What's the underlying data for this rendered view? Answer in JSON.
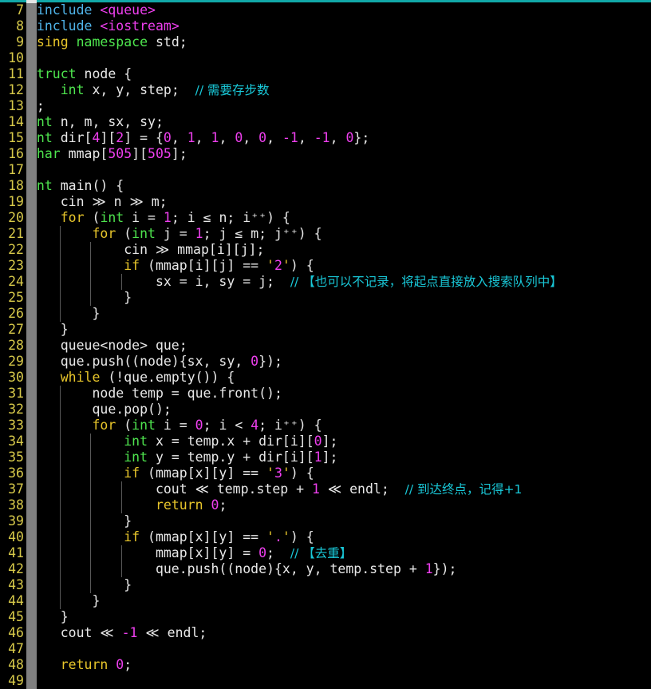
{
  "editor": {
    "language": "C++",
    "first_visible_line": 7,
    "last_visible_line": 49,
    "colors": {
      "background": "#000000",
      "line_number": "#d7c94a",
      "foreground": "#e8e8e8",
      "keyword": "#e8c62b",
      "type": "#4ee44e",
      "number": "#ee3fee",
      "preprocessor": "#4fb3e8",
      "header": "#ee3fee",
      "comment": "#19c8d8",
      "gutter_bar": "#808080",
      "top_rule": "#11a8a8",
      "indent_guide": "#585858"
    }
  },
  "lines": [
    {
      "no": "7",
      "indent_guides": 0,
      "tokens": [
        {
          "t": "#include",
          "c": "t-pre"
        },
        {
          "t": " ",
          "c": "t-plain"
        },
        {
          "t": "<queue>",
          "c": "t-hdr"
        }
      ]
    },
    {
      "no": "8",
      "indent_guides": 0,
      "tokens": [
        {
          "t": "#include",
          "c": "t-pre"
        },
        {
          "t": " ",
          "c": "t-plain"
        },
        {
          "t": "<iostream>",
          "c": "t-hdr"
        }
      ]
    },
    {
      "no": "9",
      "indent_guides": 0,
      "tokens": [
        {
          "t": "using",
          "c": "t-key"
        },
        {
          "t": " ",
          "c": "t-plain"
        },
        {
          "t": "namespace",
          "c": "t-type"
        },
        {
          "t": " std;",
          "c": "t-plain"
        }
      ]
    },
    {
      "no": "10",
      "indent_guides": 0,
      "tokens": []
    },
    {
      "no": "11",
      "indent_guides": 0,
      "tokens": [
        {
          "t": "struct",
          "c": "t-type"
        },
        {
          "t": " node {",
          "c": "t-plain"
        }
      ]
    },
    {
      "no": "12",
      "indent_guides": 0,
      "tokens": [
        {
          "t": "    ",
          "c": "t-plain"
        },
        {
          "t": "int",
          "c": "t-type"
        },
        {
          "t": " x, y, step;  ",
          "c": "t-plain"
        },
        {
          "t": "// 需要存步数",
          "c": "t-cmt"
        }
      ]
    },
    {
      "no": "13",
      "indent_guides": 0,
      "tokens": [
        {
          "t": "};",
          "c": "t-plain"
        }
      ]
    },
    {
      "no": "14",
      "indent_guides": 0,
      "tokens": [
        {
          "t": "int",
          "c": "t-type"
        },
        {
          "t": " n, m, sx, sy;",
          "c": "t-plain"
        }
      ]
    },
    {
      "no": "15",
      "indent_guides": 0,
      "tokens": [
        {
          "t": "int",
          "c": "t-type"
        },
        {
          "t": " dir[",
          "c": "t-plain"
        },
        {
          "t": "4",
          "c": "t-num"
        },
        {
          "t": "][",
          "c": "t-plain"
        },
        {
          "t": "2",
          "c": "t-num"
        },
        {
          "t": "] = {",
          "c": "t-plain"
        },
        {
          "t": "0",
          "c": "t-num"
        },
        {
          "t": ", ",
          "c": "t-plain"
        },
        {
          "t": "1",
          "c": "t-num"
        },
        {
          "t": ", ",
          "c": "t-plain"
        },
        {
          "t": "1",
          "c": "t-num"
        },
        {
          "t": ", ",
          "c": "t-plain"
        },
        {
          "t": "0",
          "c": "t-num"
        },
        {
          "t": ", ",
          "c": "t-plain"
        },
        {
          "t": "0",
          "c": "t-num"
        },
        {
          "t": ", ",
          "c": "t-plain"
        },
        {
          "t": "-1",
          "c": "t-num"
        },
        {
          "t": ", ",
          "c": "t-plain"
        },
        {
          "t": "-1",
          "c": "t-num"
        },
        {
          "t": ", ",
          "c": "t-plain"
        },
        {
          "t": "0",
          "c": "t-num"
        },
        {
          "t": "};",
          "c": "t-plain"
        }
      ]
    },
    {
      "no": "16",
      "indent_guides": 0,
      "tokens": [
        {
          "t": "char",
          "c": "t-type"
        },
        {
          "t": " mmap[",
          "c": "t-plain"
        },
        {
          "t": "505",
          "c": "t-num"
        },
        {
          "t": "][",
          "c": "t-plain"
        },
        {
          "t": "505",
          "c": "t-num"
        },
        {
          "t": "];",
          "c": "t-plain"
        }
      ]
    },
    {
      "no": "17",
      "indent_guides": 0,
      "tokens": []
    },
    {
      "no": "18",
      "indent_guides": 0,
      "tokens": [
        {
          "t": "int",
          "c": "t-type"
        },
        {
          "t": " main() {",
          "c": "t-plain"
        }
      ]
    },
    {
      "no": "19",
      "indent_guides": 0,
      "tokens": [
        {
          "t": "    cin ≫ n ≫ m;",
          "c": "t-plain"
        }
      ]
    },
    {
      "no": "20",
      "indent_guides": 0,
      "tokens": [
        {
          "t": "    ",
          "c": "t-plain"
        },
        {
          "t": "for",
          "c": "t-key"
        },
        {
          "t": " (",
          "c": "t-plain"
        },
        {
          "t": "int",
          "c": "t-type"
        },
        {
          "t": " i = ",
          "c": "t-plain"
        },
        {
          "t": "1",
          "c": "t-num"
        },
        {
          "t": "; i ≤ n; i⁺⁺) {",
          "c": "t-plain"
        }
      ]
    },
    {
      "no": "21",
      "indent_guides": 1,
      "tokens": [
        {
          "t": "        ",
          "c": "t-plain"
        },
        {
          "t": "for",
          "c": "t-key"
        },
        {
          "t": " (",
          "c": "t-plain"
        },
        {
          "t": "int",
          "c": "t-type"
        },
        {
          "t": " j = ",
          "c": "t-plain"
        },
        {
          "t": "1",
          "c": "t-num"
        },
        {
          "t": "; j ≤ m; j⁺⁺) {",
          "c": "t-plain"
        }
      ]
    },
    {
      "no": "22",
      "indent_guides": 2,
      "tokens": [
        {
          "t": "            cin ≫ mmap[i][j];",
          "c": "t-plain"
        }
      ]
    },
    {
      "no": "23",
      "indent_guides": 2,
      "tokens": [
        {
          "t": "            ",
          "c": "t-plain"
        },
        {
          "t": "if",
          "c": "t-key"
        },
        {
          "t": " (mmap[i][j] == ",
          "c": "t-plain"
        },
        {
          "t": "'",
          "c": "t-str"
        },
        {
          "t": "2",
          "c": "t-num"
        },
        {
          "t": "'",
          "c": "t-str"
        },
        {
          "t": ") {",
          "c": "t-plain"
        }
      ]
    },
    {
      "no": "24",
      "indent_guides": 3,
      "tokens": [
        {
          "t": "                sx = i, sy = j;  ",
          "c": "t-plain"
        },
        {
          "t": "// 【也可以不记录，将起点直接放入搜索队列中】",
          "c": "t-cmt"
        }
      ]
    },
    {
      "no": "25",
      "indent_guides": 2,
      "tokens": [
        {
          "t": "            }",
          "c": "t-plain"
        }
      ]
    },
    {
      "no": "26",
      "indent_guides": 1,
      "tokens": [
        {
          "t": "        }",
          "c": "t-plain"
        }
      ]
    },
    {
      "no": "27",
      "indent_guides": 0,
      "tokens": [
        {
          "t": "    }",
          "c": "t-plain"
        }
      ]
    },
    {
      "no": "28",
      "indent_guides": 0,
      "tokens": [
        {
          "t": "    queue<node> que;",
          "c": "t-plain"
        }
      ]
    },
    {
      "no": "29",
      "indent_guides": 0,
      "tokens": [
        {
          "t": "    que.push((node){sx, sy, ",
          "c": "t-plain"
        },
        {
          "t": "0",
          "c": "t-num"
        },
        {
          "t": "});",
          "c": "t-plain"
        }
      ]
    },
    {
      "no": "30",
      "indent_guides": 0,
      "tokens": [
        {
          "t": "    ",
          "c": "t-plain"
        },
        {
          "t": "while",
          "c": "t-key"
        },
        {
          "t": " (!que.empty()) {",
          "c": "t-plain"
        }
      ]
    },
    {
      "no": "31",
      "indent_guides": 1,
      "tokens": [
        {
          "t": "        node temp = que.front();",
          "c": "t-plain"
        }
      ]
    },
    {
      "no": "32",
      "indent_guides": 1,
      "tokens": [
        {
          "t": "        que.pop();",
          "c": "t-plain"
        }
      ]
    },
    {
      "no": "33",
      "indent_guides": 1,
      "tokens": [
        {
          "t": "        ",
          "c": "t-plain"
        },
        {
          "t": "for",
          "c": "t-key"
        },
        {
          "t": " (",
          "c": "t-plain"
        },
        {
          "t": "int",
          "c": "t-type"
        },
        {
          "t": " i = ",
          "c": "t-plain"
        },
        {
          "t": "0",
          "c": "t-num"
        },
        {
          "t": "; i < ",
          "c": "t-plain"
        },
        {
          "t": "4",
          "c": "t-num"
        },
        {
          "t": "; i⁺⁺) {",
          "c": "t-plain"
        }
      ]
    },
    {
      "no": "34",
      "indent_guides": 2,
      "tokens": [
        {
          "t": "            ",
          "c": "t-plain"
        },
        {
          "t": "int",
          "c": "t-type"
        },
        {
          "t": " x = temp.x + dir[i][",
          "c": "t-plain"
        },
        {
          "t": "0",
          "c": "t-num"
        },
        {
          "t": "];",
          "c": "t-plain"
        }
      ]
    },
    {
      "no": "35",
      "indent_guides": 2,
      "tokens": [
        {
          "t": "            ",
          "c": "t-plain"
        },
        {
          "t": "int",
          "c": "t-type"
        },
        {
          "t": " y = temp.y + dir[i][",
          "c": "t-plain"
        },
        {
          "t": "1",
          "c": "t-num"
        },
        {
          "t": "];",
          "c": "t-plain"
        }
      ]
    },
    {
      "no": "36",
      "indent_guides": 2,
      "tokens": [
        {
          "t": "            ",
          "c": "t-plain"
        },
        {
          "t": "if",
          "c": "t-key"
        },
        {
          "t": " (mmap[x][y] == ",
          "c": "t-plain"
        },
        {
          "t": "'",
          "c": "t-str"
        },
        {
          "t": "3",
          "c": "t-num"
        },
        {
          "t": "'",
          "c": "t-str"
        },
        {
          "t": ") {",
          "c": "t-plain"
        }
      ]
    },
    {
      "no": "37",
      "indent_guides": 3,
      "tokens": [
        {
          "t": "                cout ≪ temp.step + ",
          "c": "t-plain"
        },
        {
          "t": "1",
          "c": "t-num"
        },
        {
          "t": " ≪ endl;  ",
          "c": "t-plain"
        },
        {
          "t": "// 到达终点，记得+1",
          "c": "t-cmt"
        }
      ]
    },
    {
      "no": "38",
      "indent_guides": 3,
      "tokens": [
        {
          "t": "                ",
          "c": "t-plain"
        },
        {
          "t": "return",
          "c": "t-key"
        },
        {
          "t": " ",
          "c": "t-plain"
        },
        {
          "t": "0",
          "c": "t-num"
        },
        {
          "t": ";",
          "c": "t-plain"
        }
      ]
    },
    {
      "no": "39",
      "indent_guides": 2,
      "tokens": [
        {
          "t": "            }",
          "c": "t-plain"
        }
      ]
    },
    {
      "no": "40",
      "indent_guides": 2,
      "tokens": [
        {
          "t": "            ",
          "c": "t-plain"
        },
        {
          "t": "if",
          "c": "t-key"
        },
        {
          "t": " (mmap[x][y] == ",
          "c": "t-plain"
        },
        {
          "t": "'",
          "c": "t-str"
        },
        {
          "t": ".",
          "c": "t-num"
        },
        {
          "t": "'",
          "c": "t-str"
        },
        {
          "t": ") {",
          "c": "t-plain"
        }
      ]
    },
    {
      "no": "41",
      "indent_guides": 3,
      "tokens": [
        {
          "t": "                mmap[x][y] = ",
          "c": "t-plain"
        },
        {
          "t": "0",
          "c": "t-num"
        },
        {
          "t": ";  ",
          "c": "t-plain"
        },
        {
          "t": "// 【去重】",
          "c": "t-cmt"
        }
      ]
    },
    {
      "no": "42",
      "indent_guides": 3,
      "tokens": [
        {
          "t": "                que.push((node){x, y, temp.step + ",
          "c": "t-plain"
        },
        {
          "t": "1",
          "c": "t-num"
        },
        {
          "t": "});",
          "c": "t-plain"
        }
      ]
    },
    {
      "no": "43",
      "indent_guides": 2,
      "tokens": [
        {
          "t": "            }",
          "c": "t-plain"
        }
      ]
    },
    {
      "no": "44",
      "indent_guides": 1,
      "tokens": [
        {
          "t": "        }",
          "c": "t-plain"
        }
      ]
    },
    {
      "no": "45",
      "indent_guides": 0,
      "tokens": [
        {
          "t": "    }",
          "c": "t-plain"
        }
      ]
    },
    {
      "no": "46",
      "indent_guides": 0,
      "tokens": [
        {
          "t": "    cout ≪ ",
          "c": "t-plain"
        },
        {
          "t": "-1",
          "c": "t-num"
        },
        {
          "t": " ≪ endl;",
          "c": "t-plain"
        }
      ]
    },
    {
      "no": "47",
      "indent_guides": 0,
      "tokens": []
    },
    {
      "no": "48",
      "indent_guides": 0,
      "tokens": [
        {
          "t": "    ",
          "c": "t-plain"
        },
        {
          "t": "return",
          "c": "t-key"
        },
        {
          "t": " ",
          "c": "t-plain"
        },
        {
          "t": "0",
          "c": "t-num"
        },
        {
          "t": ";",
          "c": "t-plain"
        }
      ]
    },
    {
      "no": "49",
      "indent_guides": 0,
      "tokens": [
        {
          "t": "}",
          "c": "t-plain"
        }
      ]
    }
  ]
}
